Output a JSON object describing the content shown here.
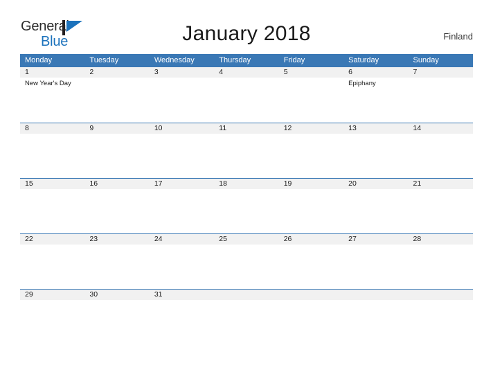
{
  "brand": {
    "name_part1": "General",
    "name_part2": "Blue",
    "flag_icon": "blue-flag-icon",
    "accent_color": "#1b72bc"
  },
  "header": {
    "title": "January 2018",
    "country": "Finland"
  },
  "colors": {
    "header_blue": "#3a78b5",
    "band_gray": "#f1f1f1",
    "rule_blue": "#3a78b5",
    "text": "#1a1a1a"
  },
  "calendar": {
    "month": "January",
    "year": "2018",
    "weekday_headers": [
      "Monday",
      "Tuesday",
      "Wednesday",
      "Thursday",
      "Friday",
      "Saturday",
      "Sunday"
    ],
    "weeks": [
      [
        {
          "day": "1",
          "events": [
            "New Year's Day"
          ]
        },
        {
          "day": "2",
          "events": []
        },
        {
          "day": "3",
          "events": []
        },
        {
          "day": "4",
          "events": []
        },
        {
          "day": "5",
          "events": []
        },
        {
          "day": "6",
          "events": [
            "Epiphany"
          ]
        },
        {
          "day": "7",
          "events": []
        }
      ],
      [
        {
          "day": "8",
          "events": []
        },
        {
          "day": "9",
          "events": []
        },
        {
          "day": "10",
          "events": []
        },
        {
          "day": "11",
          "events": []
        },
        {
          "day": "12",
          "events": []
        },
        {
          "day": "13",
          "events": []
        },
        {
          "day": "14",
          "events": []
        }
      ],
      [
        {
          "day": "15",
          "events": []
        },
        {
          "day": "16",
          "events": []
        },
        {
          "day": "17",
          "events": []
        },
        {
          "day": "18",
          "events": []
        },
        {
          "day": "19",
          "events": []
        },
        {
          "day": "20",
          "events": []
        },
        {
          "day": "21",
          "events": []
        }
      ],
      [
        {
          "day": "22",
          "events": []
        },
        {
          "day": "23",
          "events": []
        },
        {
          "day": "24",
          "events": []
        },
        {
          "day": "25",
          "events": []
        },
        {
          "day": "26",
          "events": []
        },
        {
          "day": "27",
          "events": []
        },
        {
          "day": "28",
          "events": []
        }
      ],
      [
        {
          "day": "29",
          "events": []
        },
        {
          "day": "30",
          "events": []
        },
        {
          "day": "31",
          "events": []
        },
        {
          "day": "",
          "events": []
        },
        {
          "day": "",
          "events": []
        },
        {
          "day": "",
          "events": []
        },
        {
          "day": "",
          "events": []
        }
      ]
    ]
  }
}
